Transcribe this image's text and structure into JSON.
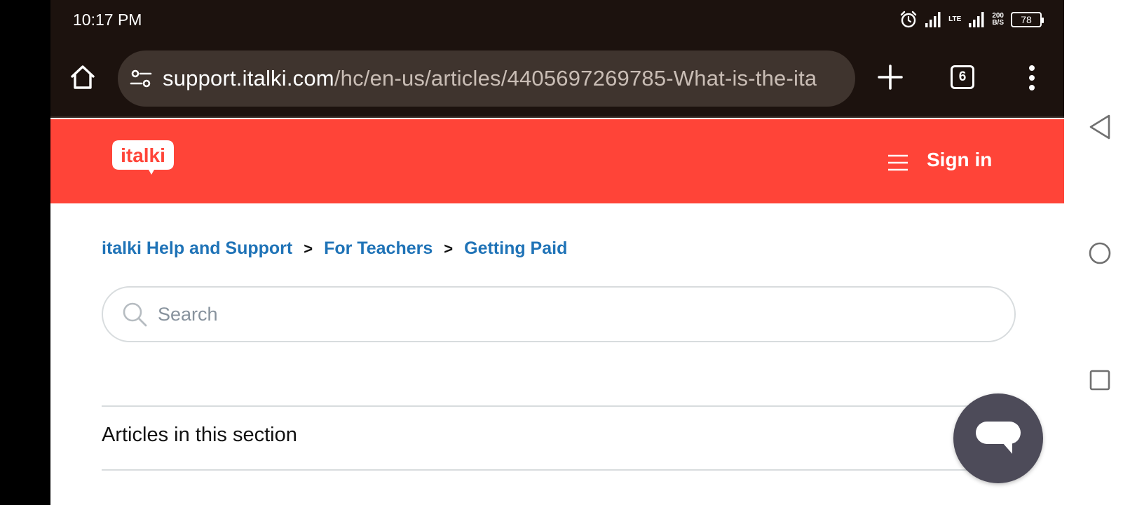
{
  "status_bar": {
    "time": "10:17 PM",
    "network_label": "LTE",
    "speed_value": "200",
    "speed_unit": "B/S",
    "battery": "78"
  },
  "browser": {
    "url_host": "support.italki.com",
    "url_path": "/hc/en-us/articles/4405697269785-What-is-the-ita",
    "tab_count": "6"
  },
  "header": {
    "logo_text": "italki",
    "sign_in_label": "Sign in",
    "brand_color": "#ff4438"
  },
  "breadcrumb": {
    "items": [
      {
        "label": "italki Help and Support"
      },
      {
        "label": "For Teachers"
      },
      {
        "label": "Getting Paid"
      }
    ],
    "separator": ">"
  },
  "search": {
    "placeholder": "Search",
    "value": ""
  },
  "section": {
    "title": "Articles in this section"
  },
  "icons": {
    "home": "home-icon",
    "site_settings": "tune-icon",
    "new_tab": "plus-icon",
    "menu": "more-vert-icon",
    "hamburger": "hamburger-icon",
    "search": "search-icon",
    "chat": "chat-bubble-icon"
  }
}
